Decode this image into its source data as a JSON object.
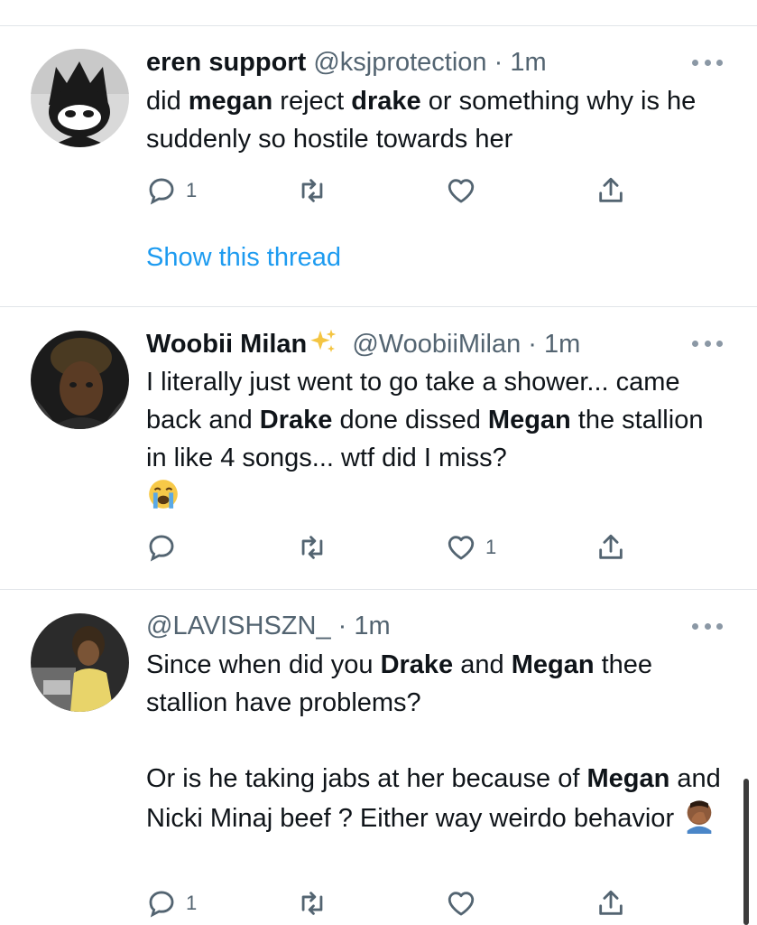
{
  "tweets": [
    {
      "name": "eren support",
      "handle": "@ksjprotection",
      "time": "· 1m",
      "body": {
        "p1_t1": "did ",
        "p1_b1": "megan",
        "p1_t2": " reject ",
        "p1_b2": "drake",
        "p1_t3": " or something why is he suddenly so hostile towards her"
      },
      "reply_count": "1",
      "retweet_count": "",
      "like_count": "",
      "show_thread": "Show this thread"
    },
    {
      "name": "Woobii Milan",
      "handle": "@WoobiiMilan",
      "time": "· 1m",
      "body": {
        "p1_t1": "I literally just went to go take a shower... came back and ",
        "p1_b1": "Drake",
        "p1_t2": " done dissed ",
        "p1_b2": "Megan",
        "p1_t3": " the stallion in like 4 songs... wtf did I miss?"
      },
      "reply_count": "",
      "retweet_count": "",
      "like_count": "1"
    },
    {
      "name": "",
      "handle": "@LAVISHSZN_",
      "time": "· 1m",
      "body": {
        "p1_t1": "Since when did you ",
        "p1_b1": "Drake",
        "p1_t2": " and ",
        "p1_b2": "Megan",
        "p1_t3": " thee stallion have problems?",
        "p2_t1": "Or is he taking jabs at her because of ",
        "p2_b1": "Megan",
        "p2_t2": " and Nicki Minaj beef ? Either way weirdo behavior "
      },
      "reply_count": "1",
      "retweet_count": "",
      "like_count": ""
    }
  ],
  "icons": [
    "reply-icon",
    "retweet-icon",
    "like-icon",
    "share-icon",
    "more-icon",
    "sparkles-emoji",
    "crying-face-emoji",
    "facepalm-emoji"
  ],
  "colors": {
    "link": "#1d9bf0",
    "secondary": "#536471",
    "text": "#0f1419",
    "divider": "#e1e5e9"
  }
}
